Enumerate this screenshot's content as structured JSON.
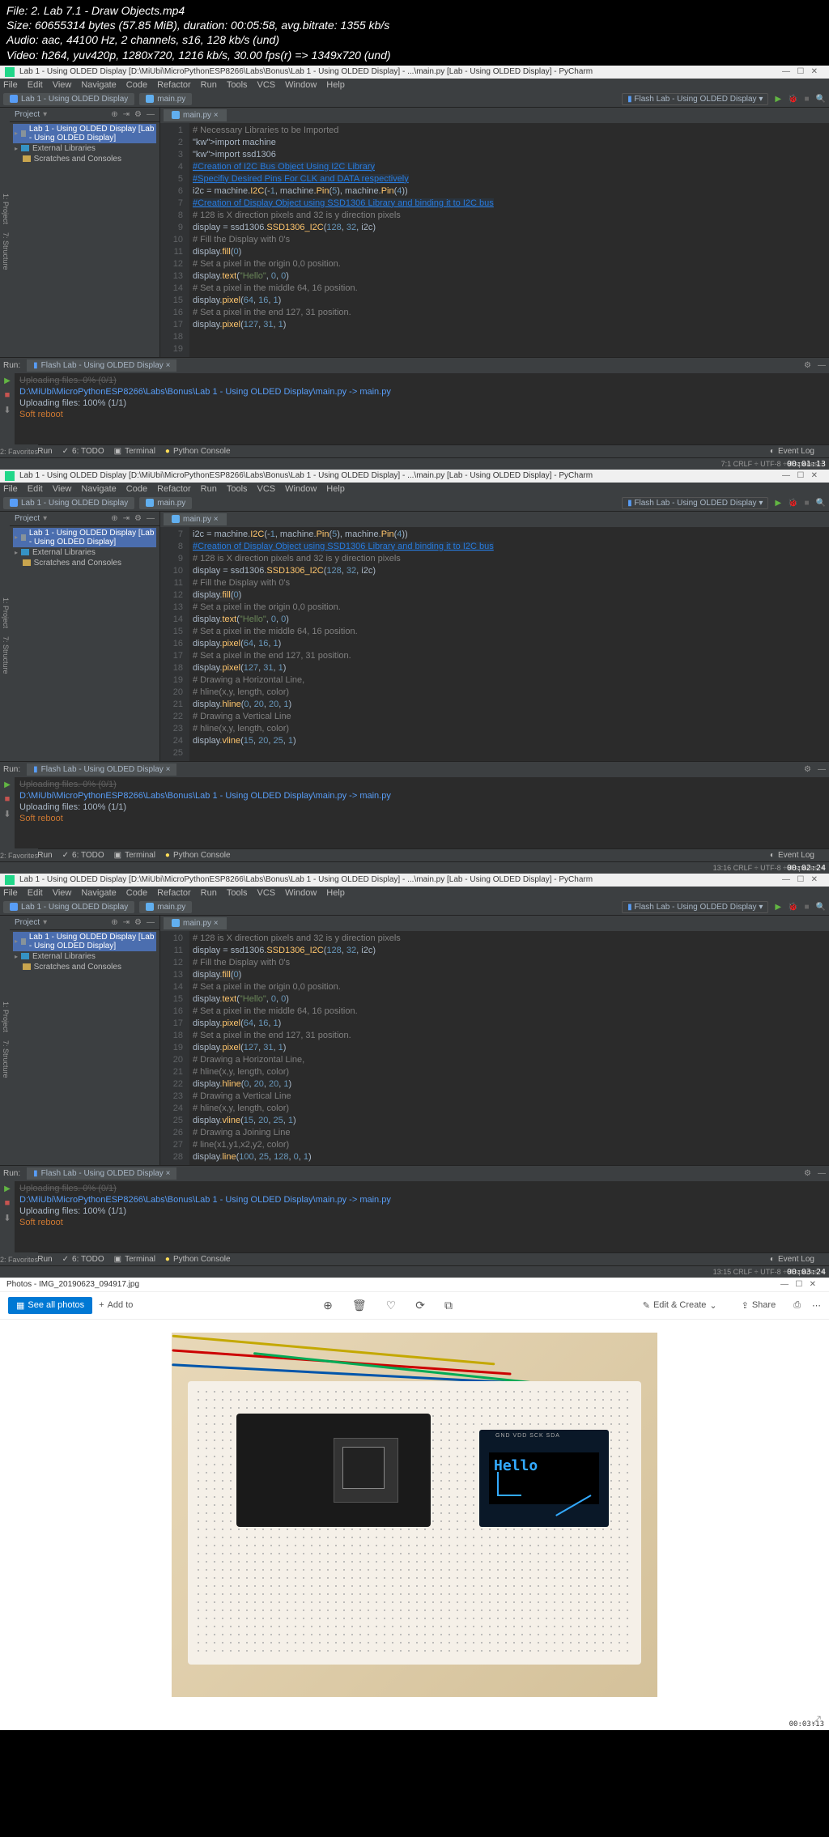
{
  "file_info": {
    "line1": "File: 2. Lab 7.1 - Draw Objects.mp4",
    "line2": "Size: 60655314 bytes (57.85 MiB), duration: 00:05:58, avg.bitrate: 1355 kb/s",
    "line3": "Audio: aac, 44100 Hz, 2 channels, s16, 128 kb/s (und)",
    "line4": "Video: h264, yuv420p, 1280x720, 1216 kb/s, 30.00 fps(r) => 1349x720 (und)"
  },
  "ide_title": "Lab 1 - Using OLDED Display [D:\\MiUbi\\MicroPythonESP8266\\Labs\\Bonus\\Lab 1 - Using OLDED Display] - ...\\main.py [Lab - Using OLDED Display] - PyCharm",
  "menu": [
    "File",
    "Edit",
    "View",
    "Navigate",
    "Code",
    "Refactor",
    "Run",
    "Tools",
    "VCS",
    "Window",
    "Help"
  ],
  "breadcrumb_tab1": "Lab 1 - Using OLDED Display",
  "breadcrumb_tab2": "main.py",
  "flash_btn": "Flash Lab - Using OLDED Display",
  "project_header": "Project",
  "tree": {
    "root": "Lab 1 - Using OLDED Display [Lab - Using OLDED Display]",
    "ext_libs": "External Libraries",
    "scratches": "Scratches and Consoles"
  },
  "editor_tab": "main.py",
  "code_s1": {
    "start": 1,
    "lines": [
      {
        "t": "c",
        "v": "# Necessary Libraries to be Imported"
      },
      {
        "t": "p",
        "v": "import machine"
      },
      {
        "t": "p",
        "v": "import ssd1306"
      },
      {
        "t": "b",
        "v": ""
      },
      {
        "t": "cl",
        "v": "#Creation of I2C Bus Object Using I2C Library"
      },
      {
        "t": "cl",
        "v": "#Specifiy Desired Pins For CLK and DATA respectively"
      },
      {
        "t": "p",
        "v": "i2c = machine.I2C(-1, machine.Pin(5), machine.Pin(4))"
      },
      {
        "t": "b",
        "v": ""
      },
      {
        "t": "cl",
        "v": "#Creation of Display Object using SSD1306 Library and binding it to I2C bus"
      },
      {
        "t": "c",
        "v": "# 128 is X direction pixels and 32 is y direction pixels"
      },
      {
        "t": "p",
        "v": "display = ssd1306.SSD1306_I2C(128, 32, i2c)"
      },
      {
        "t": "c",
        "v": "# Fill the Display with 0's"
      },
      {
        "t": "p",
        "v": "display.fill(0)"
      },
      {
        "t": "c",
        "v": "# Set a pixel in the origin 0,0 position."
      },
      {
        "t": "p",
        "v": "display.text(\"Hello\", 0, 0)"
      },
      {
        "t": "c",
        "v": "# Set a pixel in the middle 64, 16 position."
      },
      {
        "t": "p",
        "v": "display.pixel(64, 16, 1)"
      },
      {
        "t": "c",
        "v": "# Set a pixel in the end 127, 31 position."
      },
      {
        "t": "p",
        "v": "display.pixel(127, 31, 1)"
      }
    ]
  },
  "code_s2": {
    "start": 7,
    "lines": [
      {
        "n": 7,
        "t": "p",
        "v": "i2c = machine.I2C(-1, machine.Pin(5), machine.Pin(4))"
      },
      {
        "n": 8,
        "t": "b",
        "v": ""
      },
      {
        "n": 9,
        "t": "cl",
        "v": "#Creation of Display Object using SSD1306 Library and binding it to I2C bus"
      },
      {
        "n": 10,
        "t": "c",
        "v": "# 128 is X direction pixels and 32 is y direction pixels"
      },
      {
        "n": 11,
        "t": "p",
        "v": "display = ssd1306.SSD1306_I2C(128, 32, i2c)"
      },
      {
        "n": 12,
        "t": "c",
        "v": "# Fill the Display with 0's"
      },
      {
        "n": 13,
        "t": "p",
        "v": "display.fill(0)",
        "hl": true
      },
      {
        "n": 14,
        "t": "c",
        "v": "# Set a pixel in the origin 0,0 position."
      },
      {
        "n": 15,
        "t": "p",
        "v": "display.text(\"Hello\", 0, 0)"
      },
      {
        "n": 16,
        "t": "c",
        "v": "# Set a pixel in the middle 64, 16 position."
      },
      {
        "n": 17,
        "t": "p",
        "v": "display.pixel(64, 16, 1)"
      },
      {
        "n": 18,
        "t": "c",
        "v": "# Set a pixel in the end 127, 31 position."
      },
      {
        "n": 19,
        "t": "p",
        "v": "display.pixel(127, 31, 1)"
      },
      {
        "n": 20,
        "t": "c",
        "v": "# Drawing a Horizontal Line,"
      },
      {
        "n": 21,
        "t": "c",
        "v": "# hline(x,y, length, color)"
      },
      {
        "n": 22,
        "t": "p",
        "v": "display.hline(0, 20, 20, 1)"
      },
      {
        "n": 23,
        "t": "c",
        "v": "# Drawing a Vertical Line"
      },
      {
        "n": 24,
        "t": "c",
        "v": "# hline(x,y, length, color)"
      },
      {
        "n": 25,
        "t": "p",
        "v": "display.vline(15, 20, 25, 1)"
      }
    ]
  },
  "code_s3": {
    "start": 10,
    "lines": [
      {
        "n": 10,
        "t": "c",
        "v": "# 128 is X direction pixels and 32 is y direction pixels"
      },
      {
        "n": 11,
        "t": "p",
        "v": "display = ssd1306.SSD1306_I2C(128, 32, i2c)"
      },
      {
        "n": 12,
        "t": "c",
        "v": "# Fill the Display with 0's"
      },
      {
        "n": 13,
        "t": "p",
        "v": "display.fill(0)",
        "hl": true
      },
      {
        "n": 14,
        "t": "c",
        "v": "# Set a pixel in the origin 0,0 position."
      },
      {
        "n": 15,
        "t": "p",
        "v": "display.text(\"Hello\", 0, 0)"
      },
      {
        "n": 16,
        "t": "c",
        "v": "# Set a pixel in the middle 64, 16 position."
      },
      {
        "n": 17,
        "t": "p",
        "v": "display.pixel(64, 16, 1)"
      },
      {
        "n": 18,
        "t": "c",
        "v": "# Set a pixel in the end 127, 31 position."
      },
      {
        "n": 19,
        "t": "p",
        "v": "display.pixel(127, 31, 1)"
      },
      {
        "n": 20,
        "t": "c",
        "v": "# Drawing a Horizontal Line,"
      },
      {
        "n": 21,
        "t": "c",
        "v": "# hline(x,y, length, color)"
      },
      {
        "n": 22,
        "t": "p",
        "v": "display.hline(0, 20, 20, 1)"
      },
      {
        "n": 23,
        "t": "c",
        "v": "# Drawing a Vertical Line"
      },
      {
        "n": 24,
        "t": "c",
        "v": "# hline(x,y, length, color)"
      },
      {
        "n": 25,
        "t": "p",
        "v": "display.vline(15, 20, 25, 1)"
      },
      {
        "n": 26,
        "t": "c",
        "v": "# Drawing a Joining Line"
      },
      {
        "n": 27,
        "t": "c",
        "v": "# line(x1,y1,x2,y2, color)"
      },
      {
        "n": 28,
        "t": "p",
        "v": "display.line(100, 25, 128, 0, 1)"
      }
    ]
  },
  "run": {
    "label": "Run:",
    "tab": "Flash Lab - Using OLDED Display",
    "line0": "Uploading files. 0% (0/1)",
    "line1": "D:\\MiUbi\\MicroPythonESP8266\\Labs\\Bonus\\Lab 1 - Using OLDED Display\\main.py -> main.py",
    "line2": "Uploading files: 100% (1/1)",
    "line3": "Soft reboot"
  },
  "bottom": {
    "run": "4: Run",
    "todo": "6: TODO",
    "terminal": "Terminal",
    "console": "Python Console",
    "event": "Event Log"
  },
  "status": {
    "s1": "7:1   CRLF ÷   UTF-8 ÷   4 spaces ÷",
    "s2": "13:16   CRLF ÷   UTF-8 ÷   4 spaces ÷",
    "s3": "13:15   CRLF ÷   UTF-8 ÷   4 spaces ÷",
    "ts1": "00:01:13",
    "ts2": "00:02:24",
    "ts3": "00:03:24",
    "ts4": "00:03:13"
  },
  "photos": {
    "title": "Photos - IMG_20190623_094917.jpg",
    "all_photos": "See all photos",
    "add": "Add to",
    "edit": "Edit & Create",
    "share": "Share",
    "oled_text": "Hello",
    "oled_pins": "GND VDD SCK SDA"
  }
}
